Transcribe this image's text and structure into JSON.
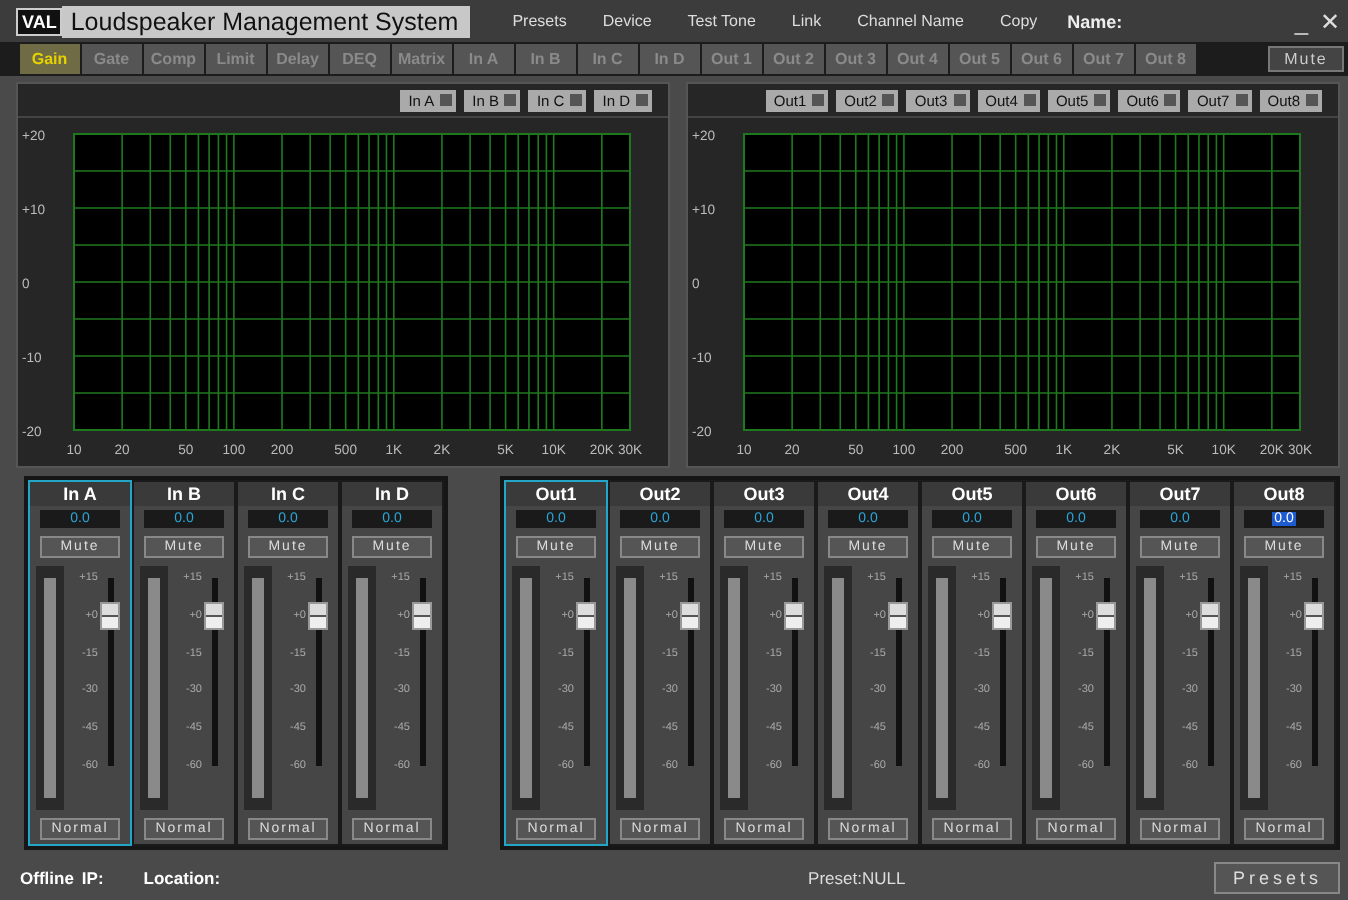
{
  "window": {
    "logo": "VAL",
    "title": "Loudspeaker Management System",
    "controls": [
      "_",
      "✕"
    ]
  },
  "menu": [
    {
      "label": "Presets"
    },
    {
      "label": "Device"
    },
    {
      "label": "Test Tone"
    },
    {
      "label": "Link"
    },
    {
      "label": "Channel Name"
    },
    {
      "label": "Copy"
    }
  ],
  "name_label": "Name:",
  "tabs": [
    {
      "label": "Gain",
      "selected": true
    },
    {
      "label": "Gate",
      "selected": false
    },
    {
      "label": "Comp",
      "selected": false
    },
    {
      "label": "Limit",
      "selected": false
    },
    {
      "label": "Delay",
      "selected": false
    },
    {
      "label": "DEQ",
      "selected": false
    },
    {
      "label": "Matrix",
      "selected": false
    },
    {
      "label": "In A",
      "selected": false
    },
    {
      "label": "In B",
      "selected": false
    },
    {
      "label": "In C",
      "selected": false
    },
    {
      "label": "In D",
      "selected": false
    },
    {
      "label": "Out 1",
      "selected": false
    },
    {
      "label": "Out 2",
      "selected": false
    },
    {
      "label": "Out 3",
      "selected": false
    },
    {
      "label": "Out 4",
      "selected": false
    },
    {
      "label": "Out 5",
      "selected": false
    },
    {
      "label": "Out 6",
      "selected": false
    },
    {
      "label": "Out 7",
      "selected": false
    },
    {
      "label": "Out 8",
      "selected": false
    }
  ],
  "mute_all": "Mute",
  "panels": [
    {
      "toggles": [
        "In A",
        "In B",
        "In C",
        "In D"
      ],
      "y_axis_labels": [
        "+20",
        "+10",
        "0",
        "-10",
        "-20"
      ],
      "x_axis_labels": [
        "10",
        "20",
        "50",
        "100",
        "200",
        "500",
        "1K",
        "2K",
        "5K",
        "10K",
        "20K",
        "30K"
      ]
    },
    {
      "toggles": [
        "Out1",
        "Out2",
        "Out3",
        "Out4",
        "Out5",
        "Out6",
        "Out7",
        "Out8"
      ],
      "y_axis_labels": [
        "+20",
        "+10",
        "0",
        "-10",
        "-20"
      ],
      "x_axis_labels": [
        "10",
        "20",
        "50",
        "100",
        "200",
        "500",
        "1K",
        "2K",
        "5K",
        "10K",
        "20K",
        "30K"
      ]
    }
  ],
  "input_channels": [
    {
      "name": "In A",
      "value": "0.0",
      "value_highlighted": false,
      "selected": true,
      "mute": "Mute",
      "mode": "Normal",
      "fader": {
        "level": 0.8
      },
      "scale": [
        "+15",
        "+0",
        "-15",
        "-30",
        "-45",
        "-60"
      ]
    },
    {
      "name": "In B",
      "value": "0.0",
      "value_highlighted": false,
      "selected": false,
      "mute": "Mute",
      "mode": "Normal",
      "fader": {
        "level": 0.8
      },
      "scale": [
        "+15",
        "+0",
        "-15",
        "-30",
        "-45",
        "-60"
      ]
    },
    {
      "name": "In C",
      "value": "0.0",
      "value_highlighted": false,
      "selected": false,
      "mute": "Mute",
      "mode": "Normal",
      "fader": {
        "level": 0.8
      },
      "scale": [
        "+15",
        "+0",
        "-15",
        "-30",
        "-45",
        "-60"
      ]
    },
    {
      "name": "In D",
      "value": "0.0",
      "value_highlighted": false,
      "selected": false,
      "mute": "Mute",
      "mode": "Normal",
      "fader": {
        "level": 0.8
      },
      "scale": [
        "+15",
        "+0",
        "-15",
        "-30",
        "-45",
        "-60"
      ]
    }
  ],
  "output_channels": [
    {
      "name": "Out1",
      "value": "0.0",
      "value_highlighted": false,
      "selected": true,
      "mute": "Mute",
      "mode": "Normal",
      "fader": {
        "level": 0.8
      },
      "scale": [
        "+15",
        "+0",
        "-15",
        "-30",
        "-45",
        "-60"
      ]
    },
    {
      "name": "Out2",
      "value": "0.0",
      "value_highlighted": false,
      "selected": false,
      "mute": "Mute",
      "mode": "Normal",
      "fader": {
        "level": 0.8
      },
      "scale": [
        "+15",
        "+0",
        "-15",
        "-30",
        "-45",
        "-60"
      ]
    },
    {
      "name": "Out3",
      "value": "0.0",
      "value_highlighted": false,
      "selected": false,
      "mute": "Mute",
      "mode": "Normal",
      "fader": {
        "level": 0.8
      },
      "scale": [
        "+15",
        "+0",
        "-15",
        "-30",
        "-45",
        "-60"
      ]
    },
    {
      "name": "Out4",
      "value": "0.0",
      "value_highlighted": false,
      "selected": false,
      "mute": "Mute",
      "mode": "Normal",
      "fader": {
        "level": 0.8
      },
      "scale": [
        "+15",
        "+0",
        "-15",
        "-30",
        "-45",
        "-60"
      ]
    },
    {
      "name": "Out5",
      "value": "0.0",
      "value_highlighted": false,
      "selected": false,
      "mute": "Mute",
      "mode": "Normal",
      "fader": {
        "level": 0.8
      },
      "scale": [
        "+15",
        "+0",
        "-15",
        "-30",
        "-45",
        "-60"
      ]
    },
    {
      "name": "Out6",
      "value": "0.0",
      "value_highlighted": false,
      "selected": false,
      "mute": "Mute",
      "mode": "Normal",
      "fader": {
        "level": 0.8
      },
      "scale": [
        "+15",
        "+0",
        "-15",
        "-30",
        "-45",
        "-60"
      ]
    },
    {
      "name": "Out7",
      "value": "0.0",
      "value_highlighted": false,
      "selected": false,
      "mute": "Mute",
      "mode": "Normal",
      "fader": {
        "level": 0.8
      },
      "scale": [
        "+15",
        "+0",
        "-15",
        "-30",
        "-45",
        "-60"
      ]
    },
    {
      "name": "Out8",
      "value": "0.0",
      "value_highlighted": true,
      "selected": false,
      "mute": "Mute",
      "mode": "Normal",
      "fader": {
        "level": 0.8
      },
      "scale": [
        "+15",
        "+0",
        "-15",
        "-30",
        "-45",
        "-60"
      ]
    }
  ],
  "status_bar": {
    "status": "Offline",
    "ip_label": "IP:",
    "location_label": "Location:",
    "preset": "Preset:NULL",
    "presets_button": "Presets"
  }
}
